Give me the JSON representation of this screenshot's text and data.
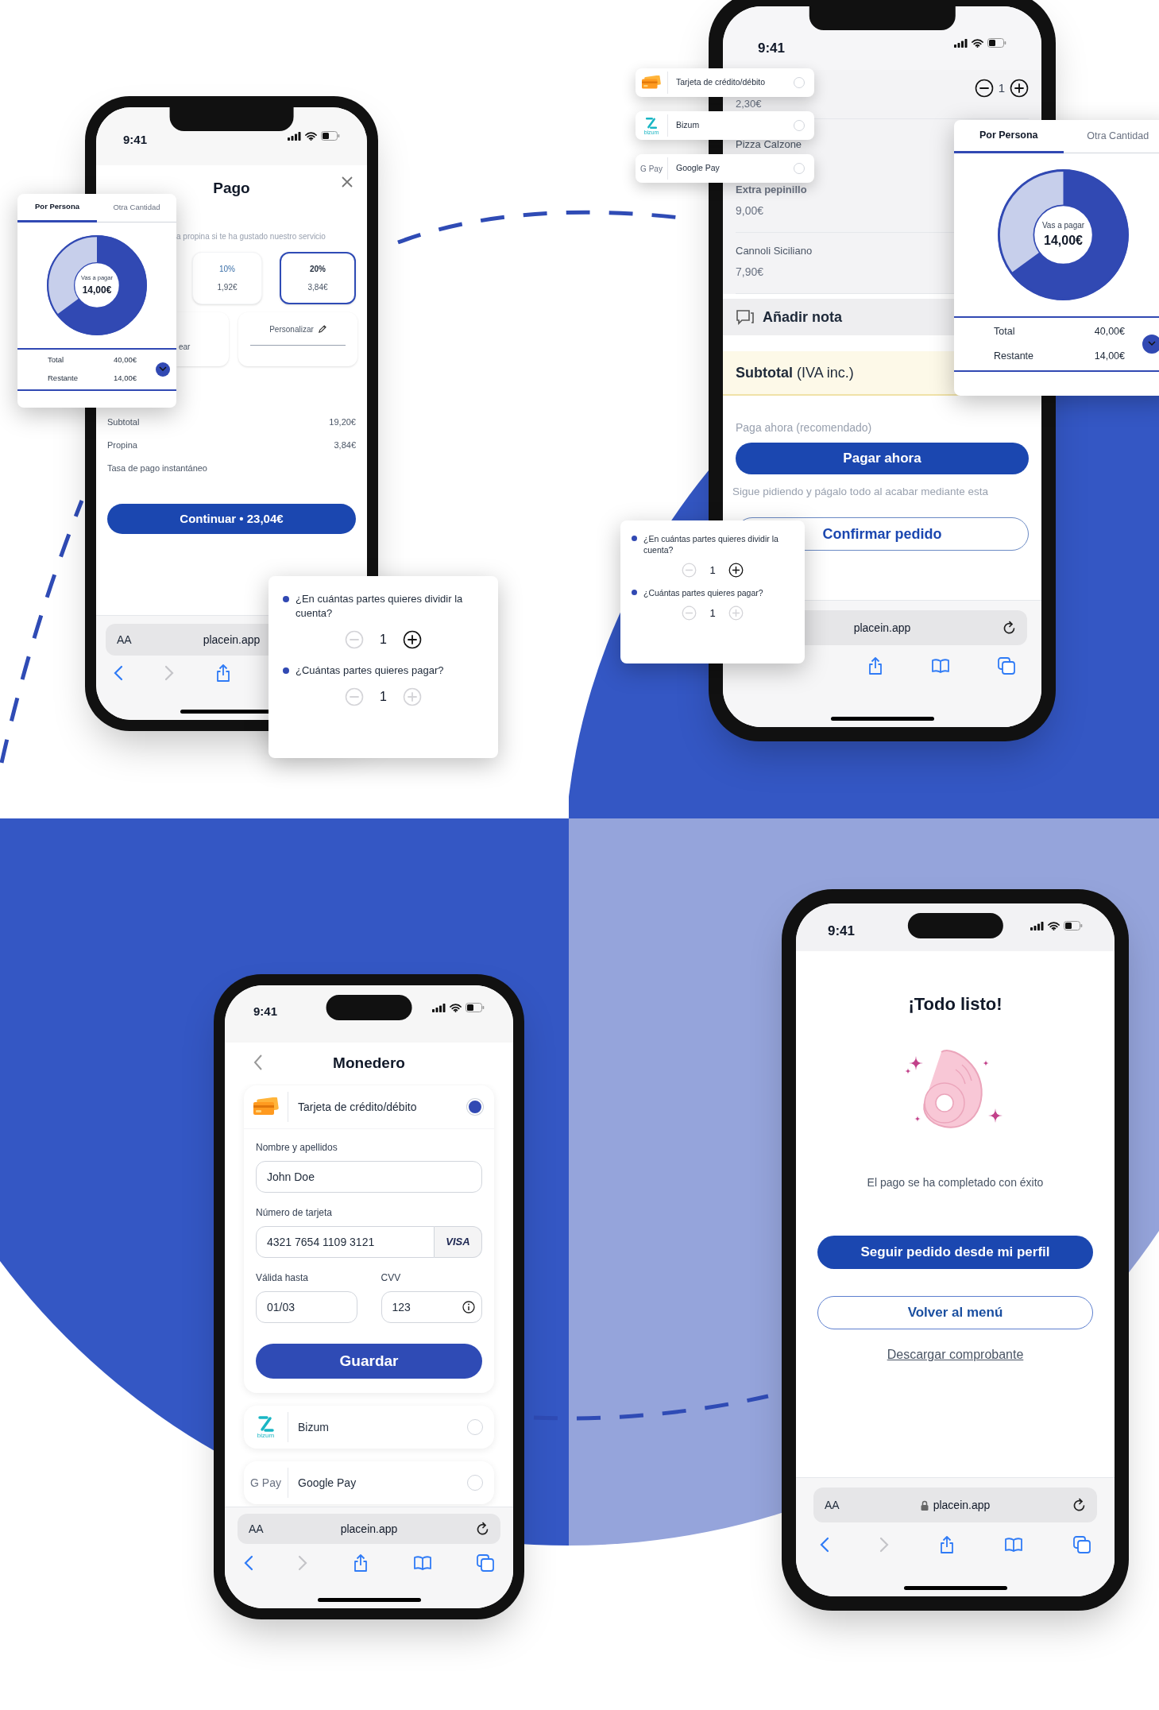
{
  "payment_phone": {
    "time": "9:41",
    "title": "Pago",
    "tip_prompt": "a propina si te ha gustado nuestro servicio",
    "tip_options": [
      {
        "percent": "10%",
        "amount": "1,92€",
        "selected": false
      },
      {
        "percent": "20%",
        "amount": "3,84€",
        "selected": true
      }
    ],
    "tip_extras": [
      {
        "kind": "partial",
        "label": "ear"
      },
      {
        "kind": "custom",
        "label": "Personalizar"
      }
    ],
    "summary": [
      {
        "label": "Subtotal",
        "value": "19,20€"
      },
      {
        "label": "Propina",
        "value": "3,84€"
      },
      {
        "label": "Tasa de pago instantáneo"
      }
    ],
    "continue_button": "Continuar • 23,04€",
    "browser": {
      "text_size": "AA",
      "url": "placein.app"
    }
  },
  "split_card_left": {
    "tabs": [
      {
        "label": "Por Persona",
        "selected": true
      },
      {
        "label": "Otra Cantidad",
        "selected": false
      }
    ],
    "center_label": "Vas a pagar",
    "amount": "14,00€",
    "rows": [
      {
        "label": "Total",
        "value": "40,00€"
      },
      {
        "label": "Restante",
        "value": "14,00€"
      }
    ]
  },
  "split_questions_left": {
    "questions": [
      {
        "text": "¿En cuántas partes quieres dividir la cuenta?",
        "value": "1",
        "minus_disabled": true,
        "plus_disabled": false
      },
      {
        "text": "¿Cuántas partes quieres pagar?",
        "value": "1",
        "minus_disabled": true,
        "plus_disabled": true
      }
    ]
  },
  "order_phone": {
    "time": "9:41",
    "items": [
      {
        "quantity": "1",
        "price": "2,30€"
      },
      {
        "name": "Pizza Calzone",
        "extra": "Extra pepinillo",
        "price": "9,00€"
      },
      {
        "name": "Cannoli Siciliano",
        "price": "7,90€"
      }
    ],
    "note_button": "Añadir nota",
    "subtotal": "**Subtotal** (IVA inc.)",
    "pay_now_hint": "Paga ahora (recomendado)",
    "pay_now_button": "Pagar ahora",
    "later_hint": "Sigue pidiendo y págalo todo al acabar mediante esta",
    "confirm_button": "Confirmar pedido",
    "browser": {
      "url": "placein.app"
    }
  },
  "payment_methods_popup": {
    "methods": [
      {
        "kind": "card",
        "name": "Tarjeta de crédito/débito",
        "selected": false
      },
      {
        "kind": "bizum",
        "name": "Bizum",
        "logo_text": "bizum",
        "selected": false
      },
      {
        "kind": "gpay",
        "name": "Google Pay",
        "logo_text": "G Pay",
        "selected": false
      }
    ]
  },
  "split_card_right": {
    "tabs": [
      {
        "label": "Por Persona",
        "selected": true
      },
      {
        "label": "Otra Cantidad",
        "selected": false
      }
    ],
    "center_label": "Vas a pagar",
    "amount": "14,00€",
    "rows": [
      {
        "label": "Total",
        "value": "40,00€"
      },
      {
        "label": "Restante",
        "value": "14,00€"
      }
    ]
  },
  "split_questions_right": {
    "questions": [
      {
        "text": "¿En cuántas partes quieres dividir la cuenta?",
        "value": "1",
        "minus_disabled": true,
        "plus_disabled": false
      },
      {
        "text": "¿Cuántas partes quieres pagar?",
        "value": "1",
        "minus_disabled": true,
        "plus_disabled": true
      }
    ]
  },
  "wallet_phone": {
    "time": "9:41",
    "title": "Monedero",
    "methods": [
      {
        "kind": "card",
        "name": "Tarjeta de crédito/débito",
        "selected": true
      },
      {
        "kind": "bizum",
        "name": "Bizum",
        "logo_text": "bizum",
        "selected": false
      },
      {
        "kind": "gpay",
        "name": "Google Pay",
        "logo_text": "G Pay",
        "selected": false
      }
    ],
    "form": {
      "name_label": "Nombre y apellidos",
      "name_value": "John Doe",
      "number_label": "Número de tarjeta",
      "number_value": "4321 7654 1109 3121",
      "brand": "VISA",
      "expiry_label": "Válida hasta",
      "expiry_value": "01/03",
      "cvv_label": "CVV",
      "cvv_value": "123",
      "save_button": "Guardar"
    },
    "browser": {
      "text_size": "AA",
      "url": "placein.app"
    }
  },
  "success_phone": {
    "time": "9:41",
    "title": "¡Todo listo!",
    "message": "El pago se ha completado con éxito",
    "primary_button": "Seguir pedido desde mi perfil",
    "secondary_button": "Volver al menú",
    "link": "Descargar comprobante",
    "browser": {
      "text_size": "AA",
      "url": "placein.app",
      "locked": true
    }
  }
}
